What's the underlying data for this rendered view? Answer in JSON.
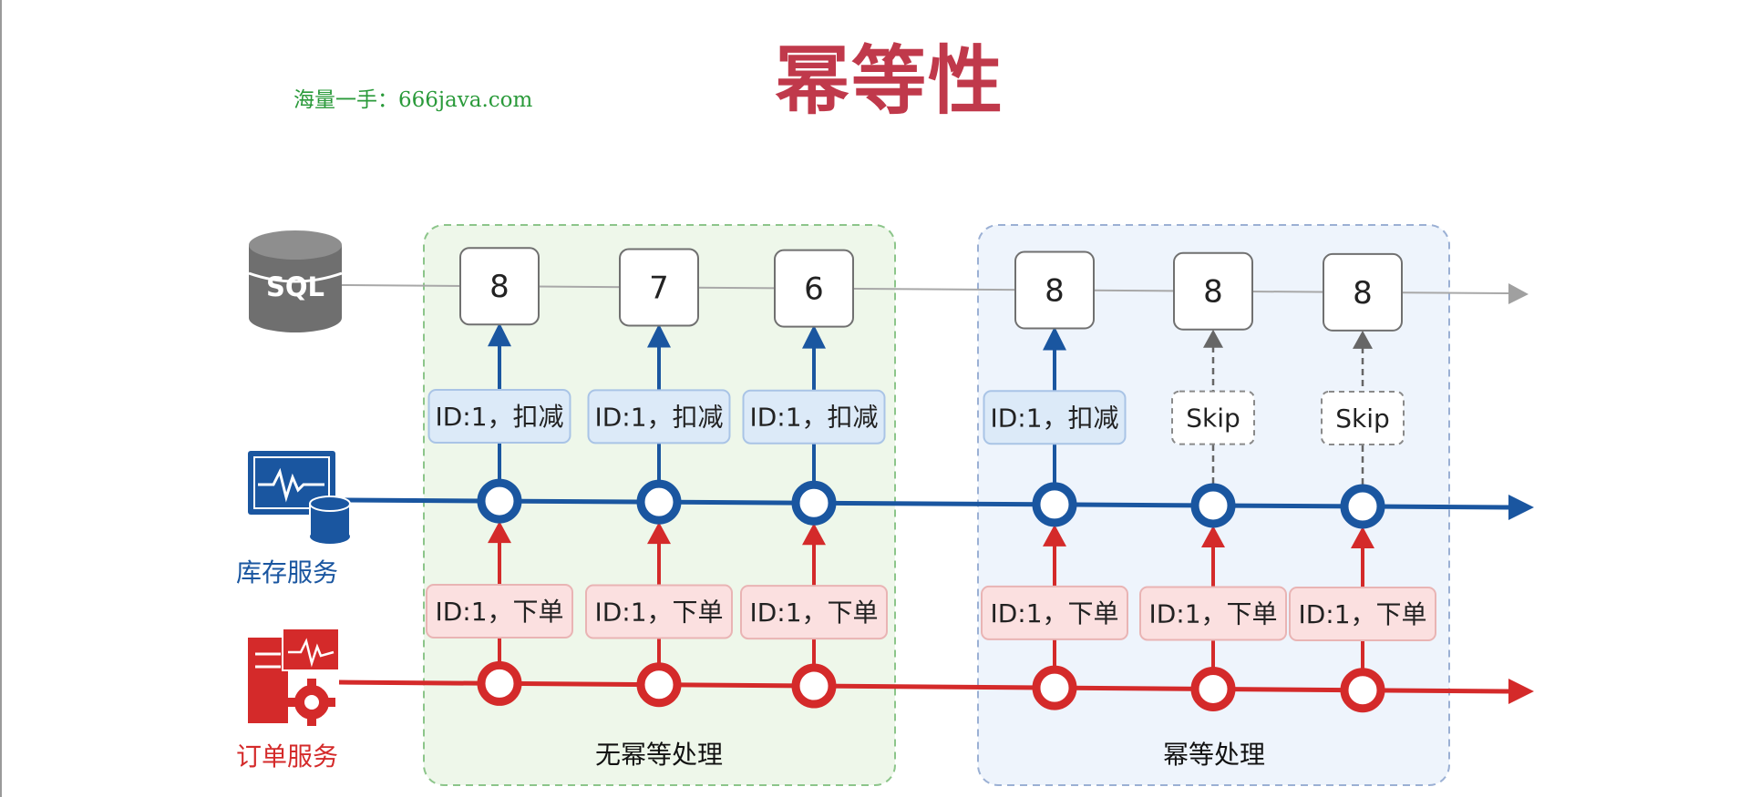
{
  "title": "幂等性",
  "watermark": "海量一手：666java.com",
  "db_label": "SQL",
  "services": {
    "inventory": "库存服务",
    "order": "订单服务"
  },
  "regions": {
    "left": "无幂等处理",
    "right": "幂等处理"
  },
  "steps": [
    {
      "stock": "8",
      "inventory_msg": "ID:1，扣减",
      "order_msg": "ID:1，下单",
      "skipped": false
    },
    {
      "stock": "7",
      "inventory_msg": "ID:1，扣减",
      "order_msg": "ID:1，下单",
      "skipped": false
    },
    {
      "stock": "6",
      "inventory_msg": "ID:1，扣减",
      "order_msg": "ID:1，下单",
      "skipped": false
    },
    {
      "stock": "8",
      "inventory_msg": "ID:1，扣减",
      "order_msg": "ID:1，下单",
      "skipped": false
    },
    {
      "stock": "8",
      "inventory_msg": "Skip",
      "order_msg": "ID:1，下单",
      "skipped": true
    },
    {
      "stock": "8",
      "inventory_msg": "Skip",
      "order_msg": "ID:1，下单",
      "skipped": true
    }
  ],
  "colors": {
    "title": "#c0394b",
    "inventory": "#1a56a0",
    "order": "#d42a2a",
    "left_region_bg": "#eef7ea",
    "right_region_bg": "#eef4fc",
    "watermark": "#2a9a3a"
  }
}
